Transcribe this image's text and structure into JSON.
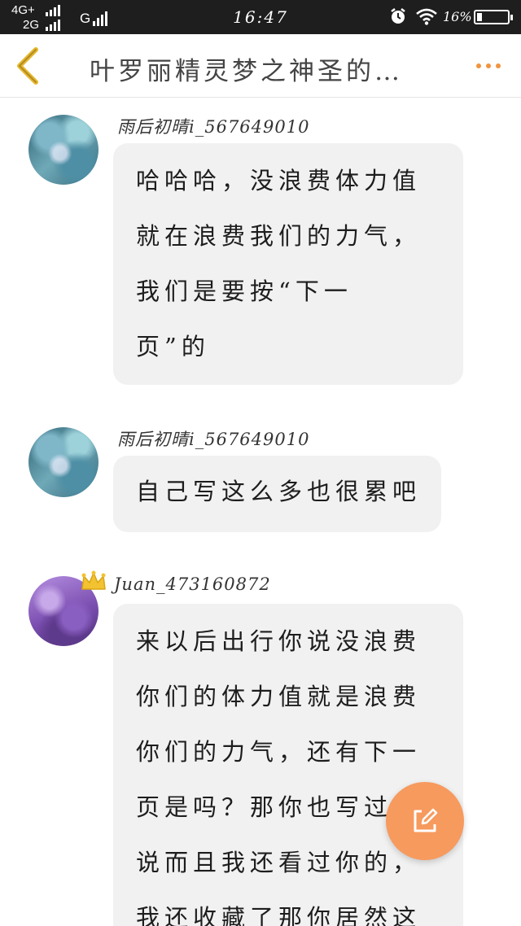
{
  "status_bar": {
    "network_top": "4G+",
    "network_bottom": "2G",
    "network_g": "G",
    "time": "16:47",
    "battery_text": "16%",
    "battery_level": 0.16,
    "alarm_icon": "alarm-clock-icon",
    "wifi_icon": "wifi-icon"
  },
  "header": {
    "title": "叶罗丽精灵梦之神圣的…",
    "back_icon": "chevron-left-icon",
    "more_icon": "more-dots-icon",
    "accent_color": "#f0943f"
  },
  "posts": [
    {
      "username": "雨后初晴i_567649010",
      "lines": [
        "哈哈哈，没浪费体力值",
        "就在浪费我们的力气，",
        "我们是要按“下一",
        "页”的"
      ]
    },
    {
      "username": "雨后初晴i_567649010",
      "lines": [
        "自己写这么多也很累吧"
      ]
    },
    {
      "username": "Juan_473160872",
      "badge_icon": "crown-icon",
      "lines": [
        "来以后出行你说没浪费",
        "你们的体力值就是浪费",
        "你们的力气，还有下一",
        "页是吗？那你也写过",
        "说而且我还看过你的，",
        "我还收藏了那你居然这"
      ]
    }
  ],
  "fab": {
    "icon": "edit-icon",
    "color": "#f79a5e"
  }
}
